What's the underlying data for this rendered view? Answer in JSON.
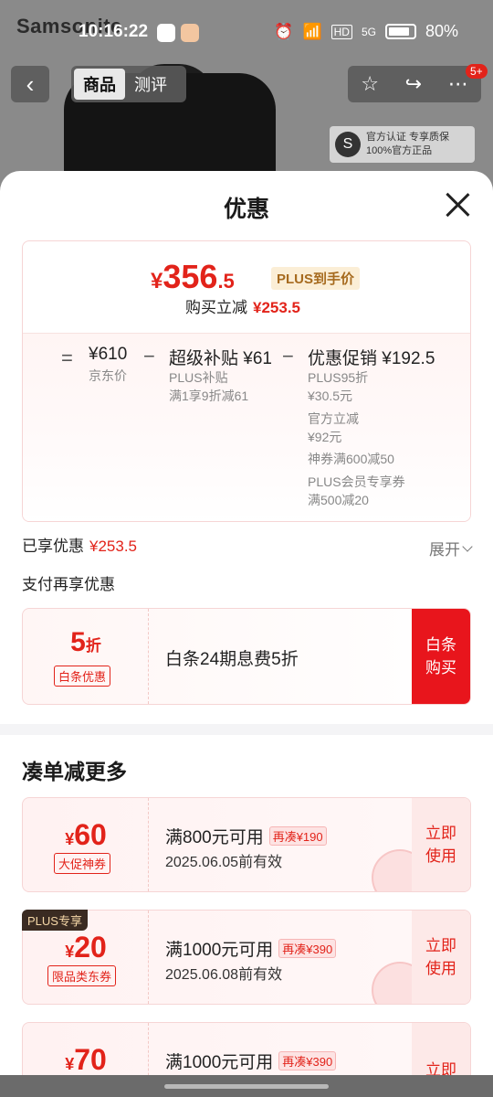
{
  "status": {
    "time": "10:16:22",
    "signal": "5G",
    "hd": "HD",
    "battery": "80%"
  },
  "background": {
    "brand": "Samsonite",
    "tabs": [
      "商品",
      "测评"
    ],
    "message_badge": "5+",
    "official_line1": "官方认证 专享质保",
    "official_line2": "100%官方正品"
  },
  "sheet": {
    "title": "优惠",
    "final_price_symbol": "¥",
    "final_price_int": "356",
    "final_price_dec": ".5",
    "plus_tag": "PLUS到手价",
    "direct_label": "购买立减",
    "direct_value": "¥253.5",
    "breakdown": {
      "equals": "=",
      "minus1": "−",
      "minus2": "−",
      "jd_price": "¥610",
      "jd_label": "京东价",
      "subsidy": "超级补贴 ¥61",
      "subsidy_sub1": "PLUS补贴",
      "subsidy_sub2": "满1享9折减61",
      "promo": "优惠促销 ¥192.5",
      "promo_sub": [
        "PLUS95折",
        "¥30.5元",
        "官方立减",
        "¥92元",
        "神券满600减50",
        "PLUS会员专享券",
        "满500减20"
      ]
    },
    "enjoyed_label": "已享优惠",
    "enjoyed_value": "¥253.5",
    "expand_label": "展开",
    "pay_title": "支付再享优惠",
    "baitiao": {
      "discount_num": "5",
      "discount_unit": "折",
      "tag": "白条优惠",
      "desc": "白条24期息费5折",
      "buy_line1": "白条",
      "buy_line2": "购买"
    },
    "more_title": "凑单减更多",
    "coupons": [
      {
        "symbol": "¥",
        "amount": "60",
        "tag": "大促神券",
        "condition": "满800元可用",
        "extra": "再凑¥190",
        "date": "2025.06.05前有效",
        "use1": "立即",
        "use2": "使用"
      },
      {
        "symbol": "¥",
        "amount": "20",
        "tag": "限品类东券",
        "condition": "满1000元可用",
        "extra": "再凑¥390",
        "date": "2025.06.08前有效",
        "use1": "立即",
        "use2": "使用",
        "badge": "PLUS专享"
      },
      {
        "symbol": "¥",
        "amount": "70",
        "tag": "",
        "condition": "满1000元可用",
        "extra": "再凑¥390",
        "date": "",
        "use1": "立即",
        "use2": ""
      }
    ]
  },
  "colors": {
    "accent_red": "#e2231a",
    "plus_gold": "#a66a1e"
  }
}
